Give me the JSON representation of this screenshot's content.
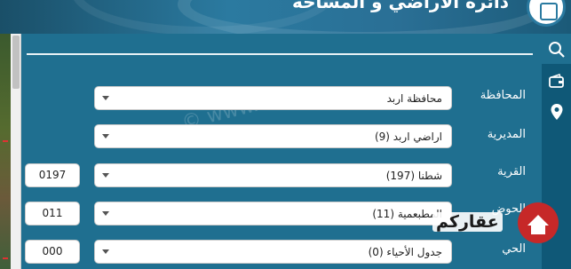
{
  "header": {
    "title": "دائرة الأراضي و المساحة"
  },
  "watermark": "© www.",
  "form": {
    "governorate": {
      "label": "المحافظة",
      "value": "محافظة اربد"
    },
    "directorate": {
      "label": "المديرية",
      "value": "اراضي اربد (9)"
    },
    "village": {
      "label": "القرية",
      "value": "شطنا (197)",
      "code": "0197"
    },
    "basin": {
      "label": "الحوض",
      "value": "المطبعمية (11)",
      "code": "011"
    },
    "neighborhood": {
      "label": "الحي",
      "value": "جدول الأحياء (0)",
      "code": "000"
    }
  },
  "sidebar": {
    "items": [
      {
        "icon": "search-icon"
      },
      {
        "icon": "wallet-icon"
      },
      {
        "icon": "location-pin-icon"
      }
    ]
  },
  "brand": {
    "text": "عقاركم"
  },
  "colors": {
    "panel": "#1f6f90",
    "sidebar": "#0f5877",
    "brand_red": "#c62828"
  }
}
